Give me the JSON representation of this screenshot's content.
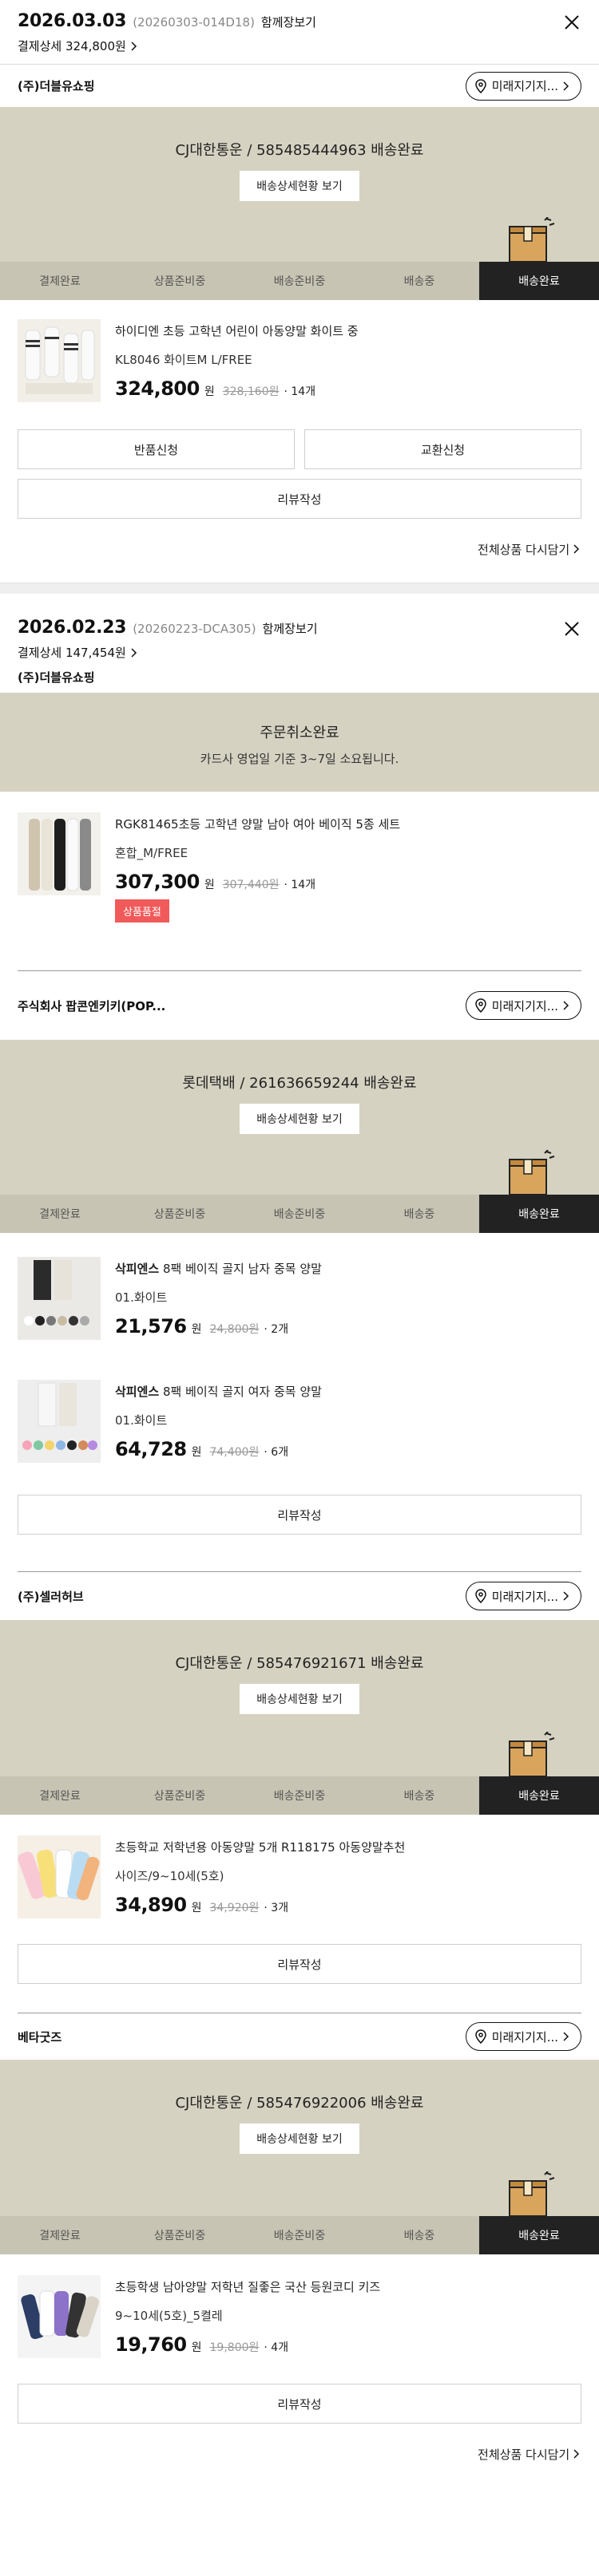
{
  "common": {
    "steps": [
      "결제완료",
      "상품준비중",
      "배송준비중",
      "배송중",
      "배송완료"
    ],
    "detail_btn": "배송상세현황 보기",
    "review_btn": "리뷰작성",
    "won": "원",
    "loc_btn": "미래지기지...",
    "reorder": "전체상품 다시담기"
  },
  "order1": {
    "date": "2026.03.03",
    "no": "(20260303-014D18)",
    "group": "함께장보기",
    "pay": "결제상세 324,800원",
    "seller": "(주)더블유쇼핑",
    "tracking": "CJ대한통운 / 585485444963 배송완료",
    "product": {
      "name": "하이디엔 초등 고학년 어린이 아동양말 화이트 중",
      "option": "KL8046 화이트M L/FREE",
      "price": "324,800",
      "orig": "328,160원",
      "qty": "· 14개"
    },
    "return_btn": "반품신청",
    "exchange_btn": "교환신청"
  },
  "order2": {
    "date": "2026.02.23",
    "no": "(20260223-DCA305)",
    "group": "함께장보기",
    "pay": "결제상세 147,454원",
    "seller": "(주)더블유쇼핑",
    "cancel_title": "주문취소완료",
    "cancel_note": "카드사 영업일 기준 3~7일 소요됩니다.",
    "product": {
      "name": "RGK81465초등 고학년 양말 남아 여아 베이직 5종 세트",
      "option": "혼합_M/FREE",
      "price": "307,300",
      "orig": "307,440원",
      "qty": "· 14개",
      "badge": "상품품절"
    }
  },
  "order3": {
    "seller": "주식회사 팝콘엔키키(POP...",
    "tracking": "롯데택배 / 261636659244 배송완료",
    "products": [
      {
        "brand": "삭피엔스",
        "name": " 8팩 베이직 골지 남자 중목 양말",
        "option": "01.화이트",
        "price": "21,576",
        "orig": "24,800원",
        "qty": "· 2개"
      },
      {
        "brand": "삭피엔스",
        "name": " 8팩 베이직 골지 여자 중목 양말",
        "option": "01.화이트",
        "price": "64,728",
        "orig": "74,400원",
        "qty": "· 6개"
      }
    ]
  },
  "order4": {
    "seller": "(주)셀러허브",
    "tracking": "CJ대한통운 / 585476921671 배송완료",
    "product": {
      "name": "초등학교 저학년용 아동양말 5개 R118175 아동양말추천",
      "option": "사이즈/9~10세(5호)",
      "price": "34,890",
      "orig": "34,920원",
      "qty": "· 3개"
    }
  },
  "order5": {
    "seller": "베타굿즈",
    "tracking": "CJ대한통운 / 585476922006 배송완료",
    "product": {
      "name": "초등학생 남아양말 저학년 질좋은 국산 등원코디 키즈",
      "option": "9~10세(5호)_5켤레",
      "price": "19,760",
      "orig": "19,800원",
      "qty": "· 4개"
    }
  },
  "colors": {
    "band": "#d6d2c2",
    "active_step": "#222222",
    "soldout": "#f15a5a"
  }
}
